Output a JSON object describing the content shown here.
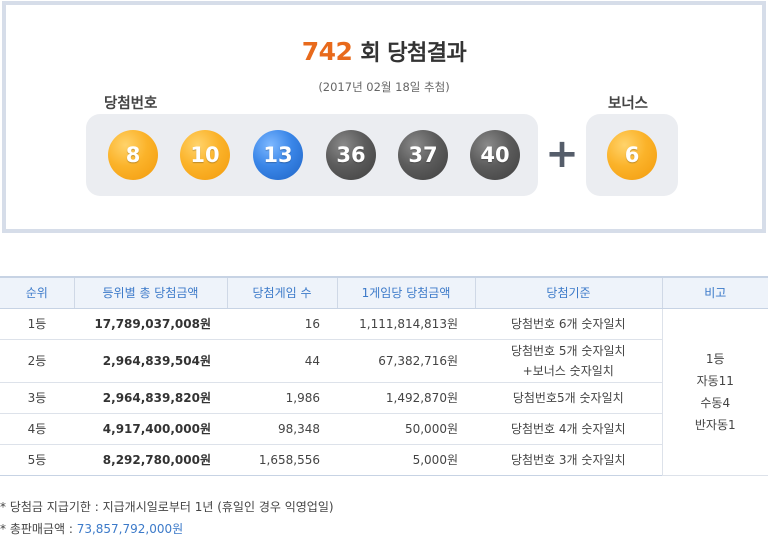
{
  "result": {
    "round_number": "742",
    "round_suffix": "회 당첨결과",
    "draw_date": "(2017년 02월 18일 추첨)",
    "winning_label": "당첨번호",
    "bonus_label": "보너스",
    "balls": [
      "8",
      "10",
      "13",
      "36",
      "37",
      "40"
    ],
    "plus": "+",
    "bonus_ball": "6"
  },
  "table": {
    "headers": [
      "순위",
      "등위별 총 당첨금액",
      "당첨게임 수",
      "1게임당 당첨금액",
      "당첨기준",
      "비고"
    ],
    "rows": [
      {
        "rank": "1등",
        "total": "17,789,037,008원",
        "count": "16",
        "each": "1,111,814,813원",
        "criteria": "당첨번호 6개 숫자일치",
        "criteria2": ""
      },
      {
        "rank": "2등",
        "total": "2,964,839,504원",
        "count": "44",
        "each": "67,382,716원",
        "criteria": "당첨번호 5개 숫자일치",
        "criteria2": "+보너스 숫자일치"
      },
      {
        "rank": "3등",
        "total": "2,964,839,820원",
        "count": "1,986",
        "each": "1,492,870원",
        "criteria": "당첨번호5개 숫자일치",
        "criteria2": ""
      },
      {
        "rank": "4등",
        "total": "4,917,400,000원",
        "count": "98,348",
        "each": "50,000원",
        "criteria": "당첨번호 4개 숫자일치",
        "criteria2": ""
      },
      {
        "rank": "5등",
        "total": "8,292,780,000원",
        "count": "1,658,556",
        "each": "5,000원",
        "criteria": "당첨번호 3개 숫자일치",
        "criteria2": ""
      }
    ],
    "note_lines": [
      "1등",
      "자동11",
      "수동4",
      "반자동1"
    ]
  },
  "footnotes": {
    "deadline": "* 당첨금 지급기한 : 지급개시일로부터 1년 (휴일인 경우 익영업일)",
    "sales_label": "* 총판매금액 : ",
    "sales_value": "73,857,792,000원"
  },
  "colors": {
    "round_accent": "#e86a1c",
    "header_text": "#3c7ac9",
    "ball_yellow": "#fbb32a",
    "ball_blue": "#3a86e8",
    "ball_gray": "#5c5c5c"
  }
}
